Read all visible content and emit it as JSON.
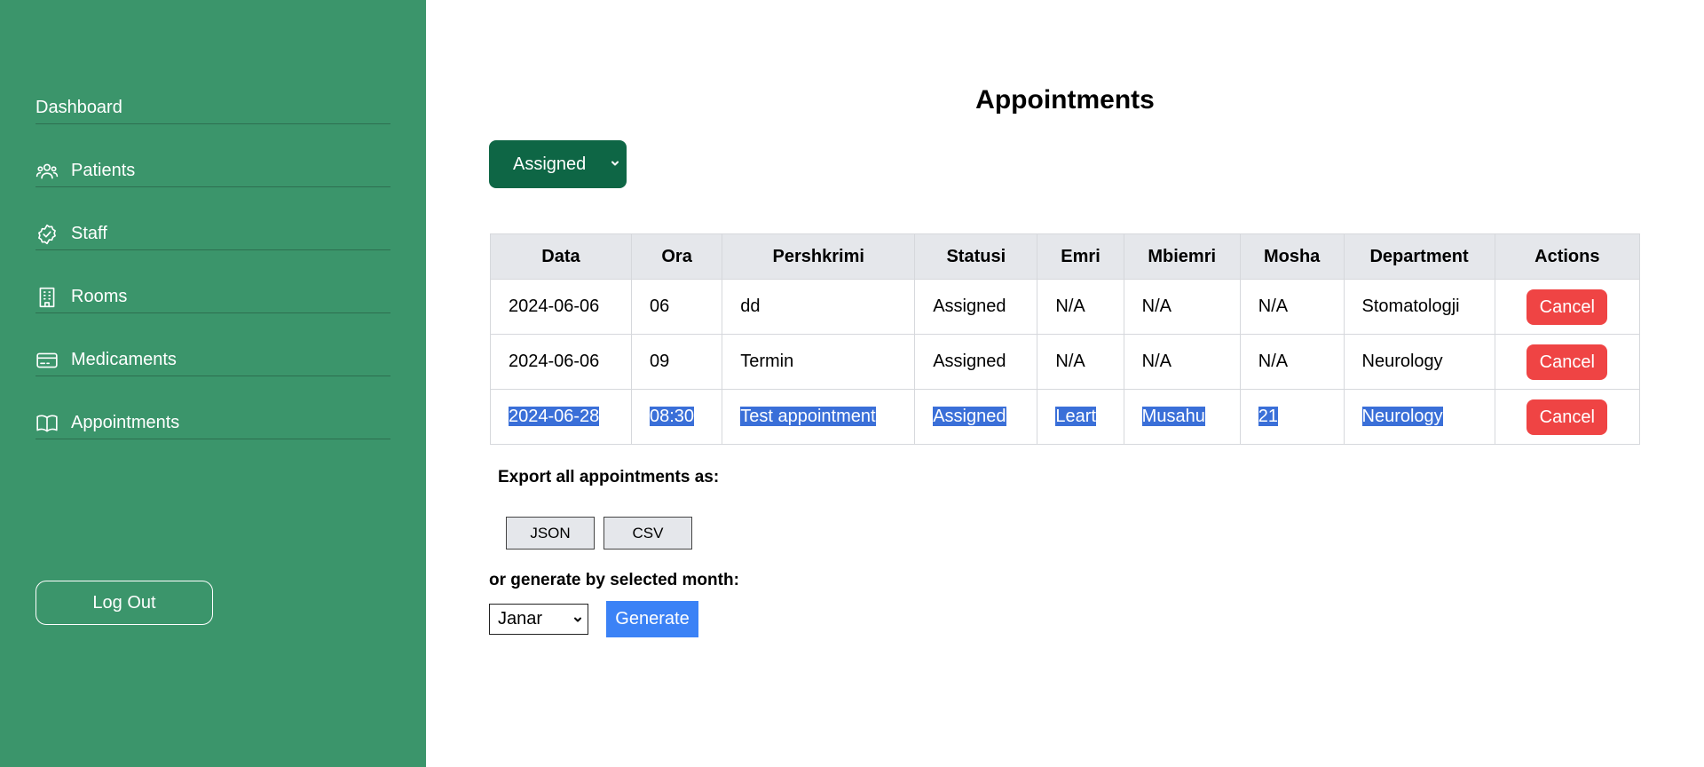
{
  "sidebar": {
    "items": [
      {
        "label": "Dashboard",
        "icon": ""
      },
      {
        "label": "Patients",
        "icon": "users-icon"
      },
      {
        "label": "Staff",
        "icon": "badge-check-icon"
      },
      {
        "label": "Rooms",
        "icon": "building-icon"
      },
      {
        "label": "Medicaments",
        "icon": "credit-card-icon"
      },
      {
        "label": "Appointments",
        "icon": "book-open-icon"
      }
    ],
    "logout_label": "Log Out"
  },
  "main": {
    "title": "Appointments",
    "status_filter": "Assigned",
    "table": {
      "headers": [
        "Data",
        "Ora",
        "Pershkrimi",
        "Statusi",
        "Emri",
        "Mbiemri",
        "Mosha",
        "Department",
        "Actions"
      ],
      "rows": [
        {
          "data": "2024-06-06",
          "ora": "06",
          "pershkrimi": "dd",
          "statusi": "Assigned",
          "emri": "N/A",
          "mbiemri": "N/A",
          "mosha": "N/A",
          "department": "Stomatologji",
          "action": "Cancel"
        },
        {
          "data": "2024-06-06",
          "ora": "09",
          "pershkrimi": "Termin",
          "statusi": "Assigned",
          "emri": "N/A",
          "mbiemri": "N/A",
          "mosha": "N/A",
          "department": "Neurology",
          "action": "Cancel"
        },
        {
          "data": "2024-06-28",
          "ora": "08:30",
          "pershkrimi": "Test appointment",
          "statusi": "Assigned",
          "emri": "Leart",
          "mbiemri": "Musahu",
          "mosha": "21",
          "department": "Neurology",
          "action": "Cancel"
        }
      ]
    },
    "export": {
      "label": "Export all appointments as:",
      "json_label": "JSON",
      "csv_label": "CSV"
    },
    "generate": {
      "label": "or generate by selected month:",
      "month": "Janar",
      "button_label": "Generate"
    }
  },
  "colors": {
    "sidebar_bg": "#3b956b",
    "filter_bg": "#0e6645",
    "cancel_bg": "#ef4444",
    "generate_bg": "#3b82f6",
    "selection_bg": "#3a6fd8"
  }
}
